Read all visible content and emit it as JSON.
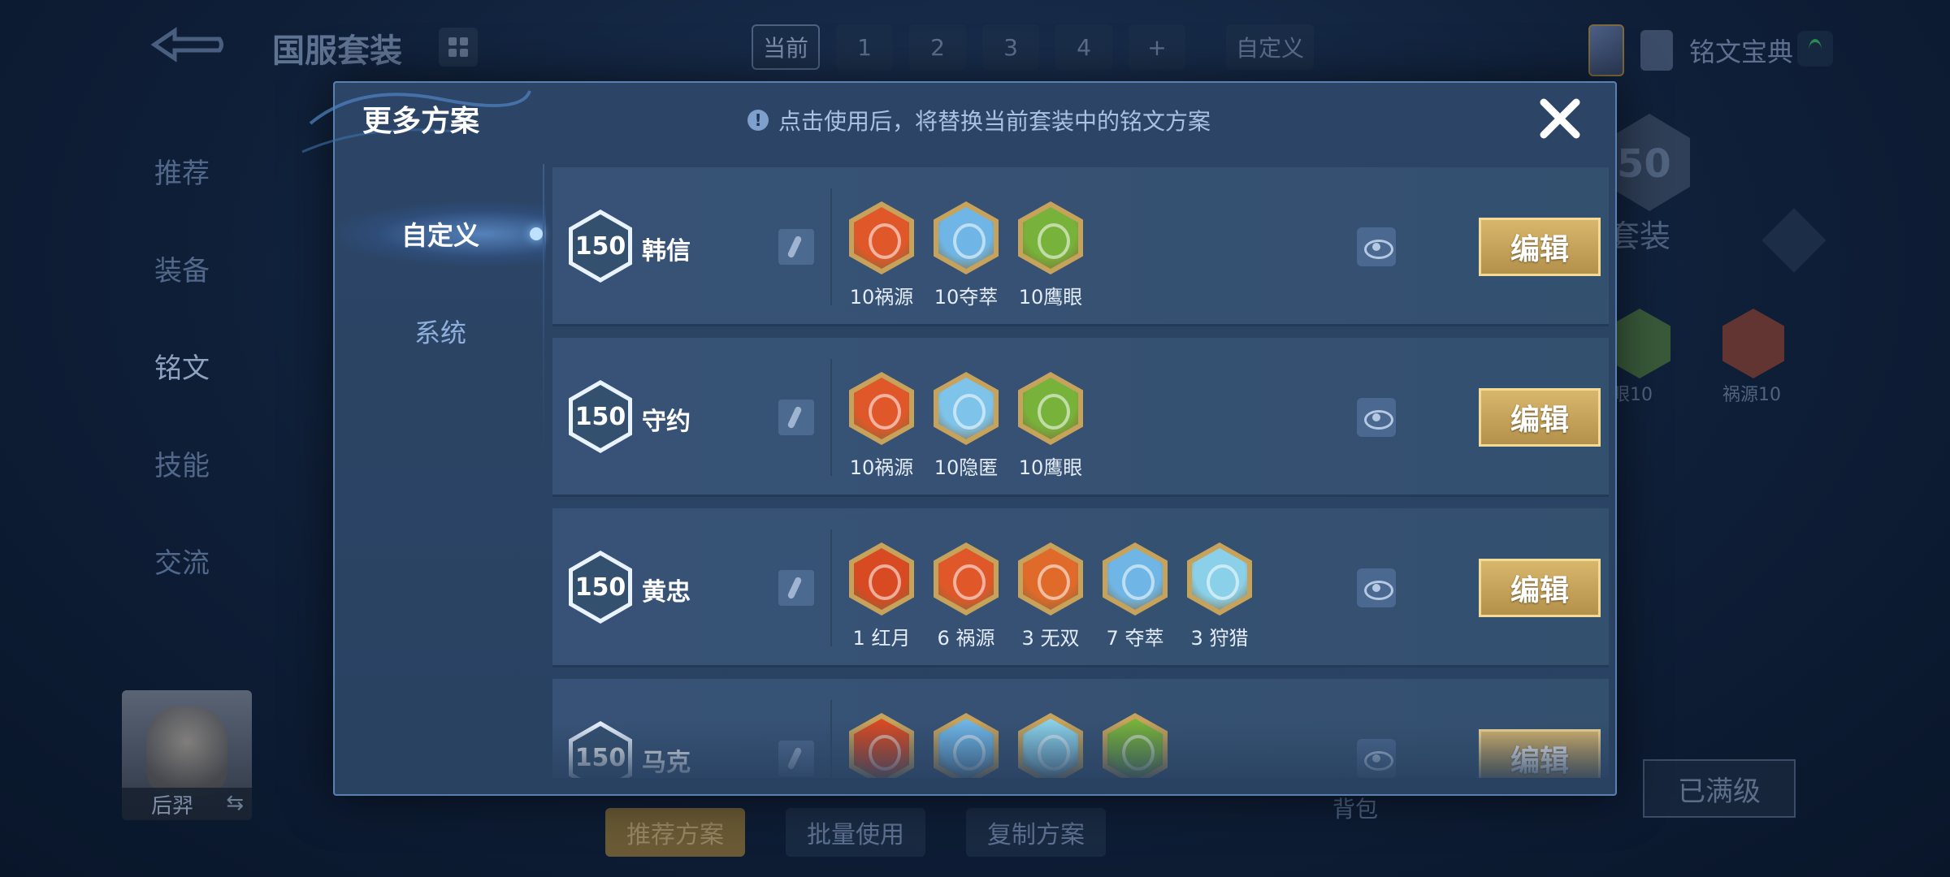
{
  "background": {
    "title": "国服套装",
    "tabs": [
      "当前",
      "1",
      "2",
      "3",
      "4",
      "+"
    ],
    "custom_tab": "自定义",
    "guide": "铭文宝典",
    "side_menu": [
      "推荐",
      "装备",
      "铭文",
      "技能",
      "交流"
    ],
    "hero_name": "后羿",
    "bottom_buttons": [
      "推荐方案",
      "批量使用",
      "复制方案"
    ],
    "bag": "背包",
    "full_level": "已满级",
    "right_level": "50",
    "right_suit": "套装",
    "right_runes": [
      "眼10",
      "祸源10"
    ]
  },
  "modal": {
    "title": "更多方案",
    "notice": "点击使用后，将替换当前套装中的铭文方案",
    "tabs": [
      "自定义",
      "系统"
    ],
    "rows": [
      {
        "level": "150",
        "hero": "韩信",
        "runes": [
          {
            "label": "10祸源",
            "color": "#e0582a"
          },
          {
            "label": "10夺萃",
            "color": "#6fb6e6"
          },
          {
            "label": "10鹰眼",
            "color": "#77b23a"
          }
        ],
        "edit": "编辑"
      },
      {
        "level": "150",
        "hero": "守约",
        "runes": [
          {
            "label": "10祸源",
            "color": "#e0582a"
          },
          {
            "label": "10隐匿",
            "color": "#7ec3ea"
          },
          {
            "label": "10鹰眼",
            "color": "#77b23a"
          }
        ],
        "edit": "编辑"
      },
      {
        "level": "150",
        "hero": "黄忠",
        "runes": [
          {
            "label": "1 红月",
            "color": "#d84a22"
          },
          {
            "label": "6 祸源",
            "color": "#e0582a"
          },
          {
            "label": "3 无双",
            "color": "#e06a2a"
          },
          {
            "label": "7 夺萃",
            "color": "#6fb6e6"
          },
          {
            "label": "3 狩猎",
            "color": "#8ad0e8"
          }
        ],
        "edit": "编辑"
      },
      {
        "level": "150",
        "hero": "马克",
        "runes": [
          {
            "label": "",
            "color": "#d84a22"
          },
          {
            "label": "",
            "color": "#6fb6e6"
          },
          {
            "label": "",
            "color": "#8ad0e8"
          },
          {
            "label": "",
            "color": "#77b23a"
          }
        ],
        "edit": "编辑"
      }
    ]
  }
}
